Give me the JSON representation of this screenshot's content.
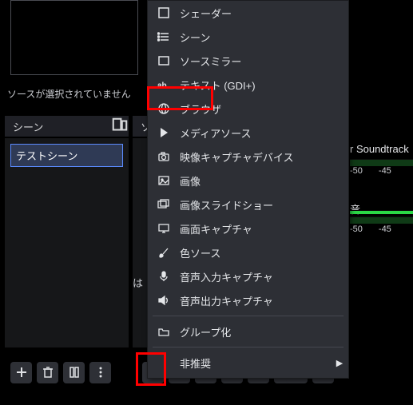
{
  "status": "ソースが選択されていません",
  "panels": {
    "scenes_title": "シーン",
    "sources_title": "ソ"
  },
  "scene_selected": "テストシーン",
  "ha_label": "は",
  "audio": {
    "desktop_label": "r Soundtrack",
    "mic_label": "音",
    "ticks": [
      "-50",
      "-45"
    ]
  },
  "menu": {
    "items": [
      "シェーダー",
      "シーン",
      "ソースミラー",
      "テキスト (GDI+)",
      "ブラウザ",
      "メディアソース",
      "映像キャプチャデバイス",
      "画像",
      "画像スライドショー",
      "画面キャプチャ",
      "色ソース",
      "音声入力キャプチャ",
      "音声出力キャプチャ",
      "グループ化",
      "非推奨"
    ]
  }
}
